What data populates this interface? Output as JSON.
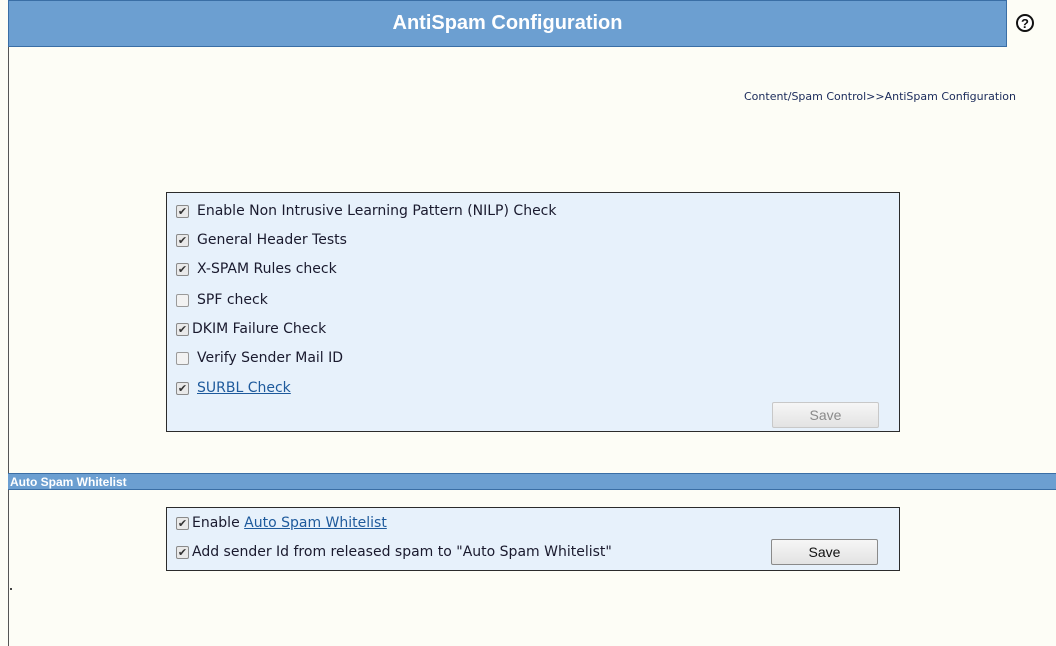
{
  "header": {
    "title": "AntiSpam Configuration",
    "help_symbol": "?",
    "help_icon": "help-circle-icon",
    "bar_color": "#6c9fd1"
  },
  "breadcrumb": "Content/Spam Control>>AntiSpam Configuration",
  "antispam": {
    "options": [
      {
        "label": "Enable Non Intrusive Learning Pattern (NILP) Check",
        "checked": true,
        "link": false
      },
      {
        "label": "General Header Tests",
        "checked": true,
        "link": false
      },
      {
        "label": "X-SPAM Rules check",
        "checked": true,
        "link": false
      },
      {
        "label": "SPF check",
        "checked": false,
        "link": false
      },
      {
        "label": "DKIM Failure Check",
        "checked": true,
        "link": false
      },
      {
        "label": "Verify Sender Mail ID",
        "checked": false,
        "link": false
      },
      {
        "label": "SURBL Check",
        "checked": true,
        "link": true
      }
    ],
    "save_label": "Save",
    "save_enabled": false
  },
  "whitelist": {
    "section_title": "Auto Spam Whitelist",
    "enable_prefix": "Enable ",
    "enable_link": "Auto Spam Whitelist",
    "enable_checked": true,
    "add_sender_label": "Add sender Id from released spam to \"Auto Spam Whitelist\"",
    "add_sender_checked": true,
    "save_label": "Save",
    "save_enabled": true
  },
  "colors": {
    "panel_bg": "#e7f1fb",
    "link": "#1e5a9c",
    "page_bg": "#fdfdf6"
  }
}
